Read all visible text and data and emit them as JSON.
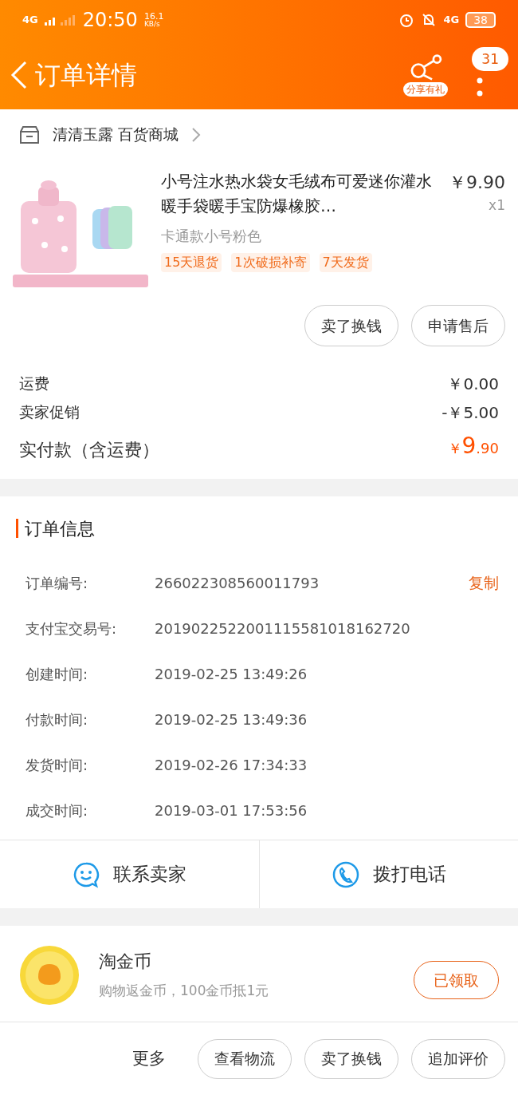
{
  "status_bar": {
    "network": "4G",
    "time": "20:50",
    "speed_value": "16.1",
    "speed_unit": "KB/s",
    "network_right": "4G",
    "battery": "38"
  },
  "header": {
    "title": "订单详情",
    "share_label": "分享有礼",
    "badge": "31"
  },
  "shop": {
    "name": "清清玉露 百货商城"
  },
  "product": {
    "title": "小号注水热水袋女毛绒布可爱迷你灌水暖手袋暖手宝防爆橡胶…",
    "price": "￥9.90",
    "quantity": "x1",
    "variant": "卡通款小号粉色",
    "tags": [
      "15天退货",
      "1次破损补寄",
      "7天发货"
    ],
    "buttons": [
      "卖了换钱",
      "申请售后"
    ]
  },
  "fees": [
    {
      "label": "运费",
      "value": "￥0.00",
      "kind": "normal"
    },
    {
      "label": "卖家促销",
      "value": "-￥5.00",
      "kind": "normal"
    },
    {
      "label": "实付款（含运费）",
      "value_symbol": "￥",
      "value_int": "9",
      "value_dec": ".90",
      "kind": "total"
    }
  ],
  "order_info": {
    "title": "订单信息",
    "copy": "复制",
    "rows": [
      {
        "label": "订单编号:",
        "value": "266022308560011793"
      },
      {
        "label": "支付宝交易号:",
        "value": "2019022522001115581018162720"
      },
      {
        "label": "创建时间:",
        "value": "2019-02-25 13:49:26"
      },
      {
        "label": "付款时间:",
        "value": "2019-02-25 13:49:36"
      },
      {
        "label": "发货时间:",
        "value": "2019-02-26 17:34:33"
      },
      {
        "label": "成交时间:",
        "value": "2019-03-01 17:53:56"
      }
    ]
  },
  "contact": [
    {
      "label": "联系卖家",
      "kind": "chat"
    },
    {
      "label": "拨打电话",
      "kind": "phone"
    }
  ],
  "coin": {
    "title": "淘金币",
    "subtitle": "购物返金币，100金币抵1元",
    "button": "已领取"
  },
  "bottom_bar": {
    "more": "更多",
    "buttons": [
      "查看物流",
      "卖了换钱",
      "追加评价"
    ]
  }
}
